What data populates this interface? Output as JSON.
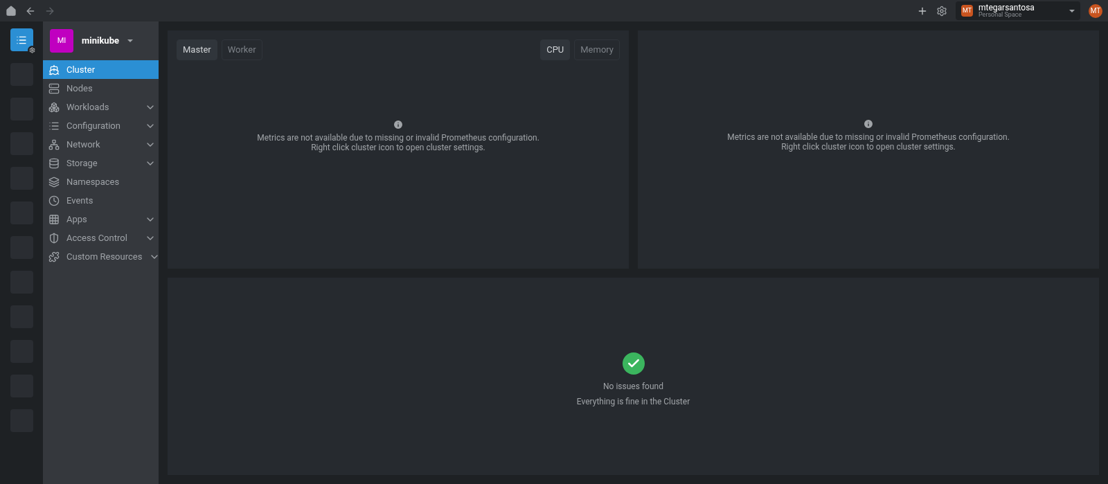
{
  "top_bar": {
    "workspace": {
      "initials": "MT",
      "name": "mtegarsantosa",
      "subtitle": "Personal Space"
    },
    "avatar": "MT"
  },
  "sidebar": {
    "cluster": {
      "initials": "MI",
      "name": "minikube",
      "color": "#c000c0"
    },
    "items": [
      {
        "label": "Cluster",
        "selected": true,
        "expandable": false
      },
      {
        "label": "Nodes",
        "selected": false,
        "expandable": false
      },
      {
        "label": "Workloads",
        "selected": false,
        "expandable": true
      },
      {
        "label": "Configuration",
        "selected": false,
        "expandable": true
      },
      {
        "label": "Network",
        "selected": false,
        "expandable": true
      },
      {
        "label": "Storage",
        "selected": false,
        "expandable": true
      },
      {
        "label": "Namespaces",
        "selected": false,
        "expandable": false
      },
      {
        "label": "Events",
        "selected": false,
        "expandable": false
      },
      {
        "label": "Apps",
        "selected": false,
        "expandable": true
      },
      {
        "label": "Access Control",
        "selected": false,
        "expandable": true
      },
      {
        "label": "Custom Resources",
        "selected": false,
        "expandable": true
      }
    ]
  },
  "metrics_panel": {
    "node_tabs": [
      {
        "label": "Master",
        "selected": true
      },
      {
        "label": "Worker",
        "selected": false
      }
    ],
    "resource_tabs": [
      {
        "label": "CPU",
        "selected": true
      },
      {
        "label": "Memory",
        "selected": false
      }
    ],
    "message": [
      "Metrics are not available due to missing or invalid Prometheus configuration.",
      "Right click cluster icon to open cluster settings."
    ]
  },
  "second_panel": {
    "message": [
      "Metrics are not available due to missing or invalid Prometheus configuration.",
      "Right click cluster icon to open cluster settings."
    ]
  },
  "issues_panel": {
    "title": "No issues found",
    "subtitle": "Everything is fine in the Cluster"
  }
}
